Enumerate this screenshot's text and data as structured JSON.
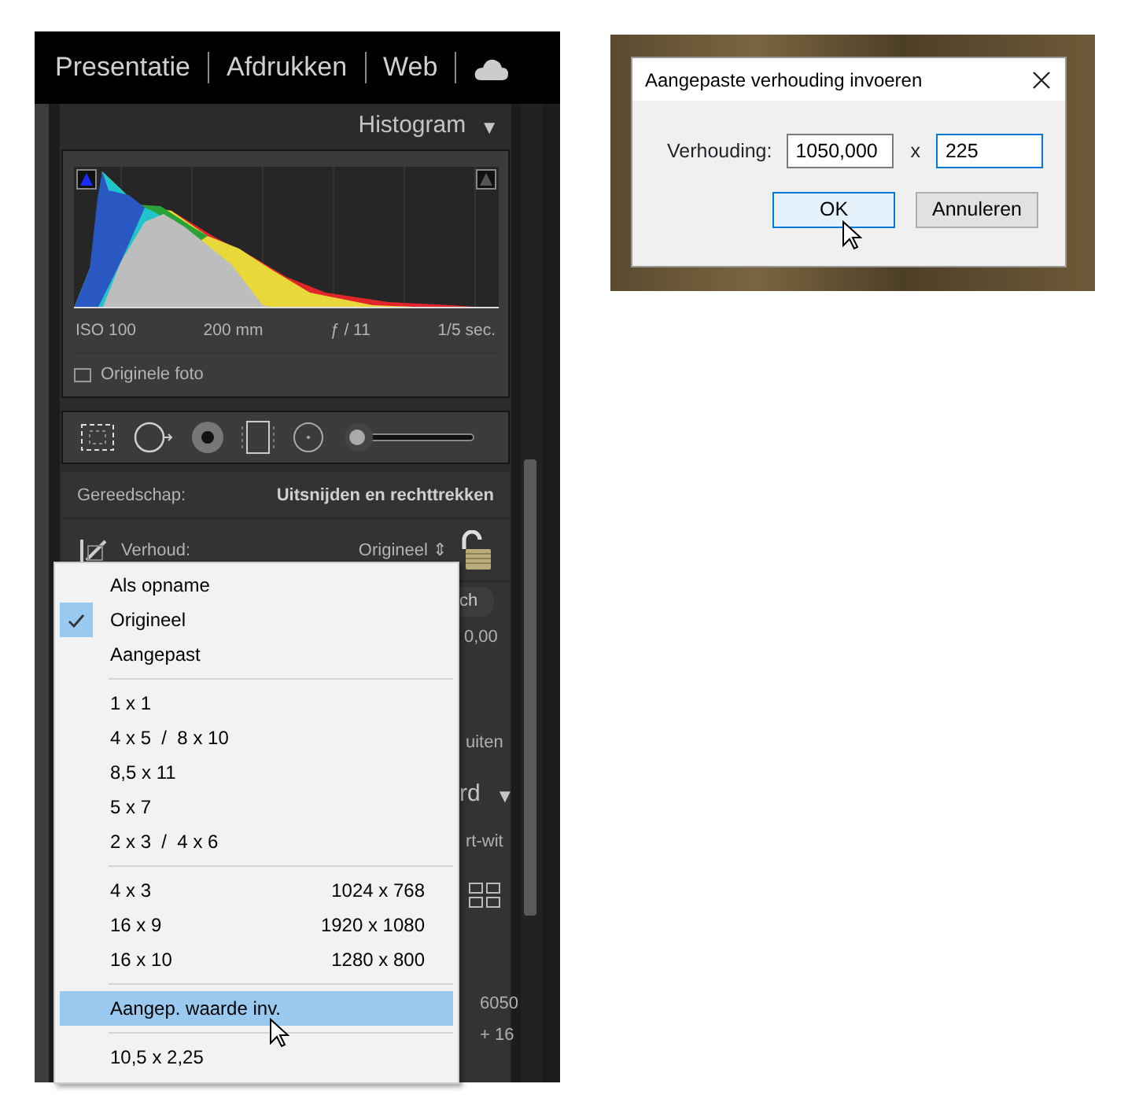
{
  "app_panel": {
    "top_nav": [
      {
        "label": "Presentatie"
      },
      {
        "label": "Afdrukken"
      },
      {
        "label": "Web"
      }
    ],
    "histogram": {
      "title": "Histogram",
      "collapse_glyph": "▼",
      "exif": [
        "ISO 100",
        "200 mm",
        "ƒ / 11",
        "1/5 sec."
      ],
      "original_photo": {
        "label": "Originele foto",
        "checked": false
      }
    },
    "brush_slider": {
      "level": 0.03
    },
    "crop_panel": {
      "tool_label": "Gereedschap:",
      "tool_value": "Uitsnijden en rechttrekken",
      "aspect_label": "Verhoud:",
      "aspect_value": "Origineel",
      "aspect_glyph": "⇕",
      "locked": false
    },
    "hidden_fragments": {
      "pill": "ch",
      "angle": "0,00",
      "reset": "uiten",
      "section_title": "rd",
      "section_glyph": "▼",
      "treatment": "rt-wit",
      "temperature": "6050",
      "tint": "+ 16"
    }
  },
  "aspect_menu": {
    "items": [
      {
        "kind": "item",
        "label": "Als opname",
        "checked": false,
        "selected": false
      },
      {
        "kind": "item",
        "label": "Origineel",
        "checked": true,
        "selected": false
      },
      {
        "kind": "item",
        "label": "Aangepast",
        "checked": false,
        "selected": false
      },
      {
        "kind": "separator"
      },
      {
        "kind": "item",
        "label": "1 x 1",
        "checked": false,
        "selected": false
      },
      {
        "kind": "item",
        "label": "4 x 5  /  8 x 10",
        "checked": false,
        "selected": false
      },
      {
        "kind": "item",
        "label": "8,5 x 11",
        "checked": false,
        "selected": false
      },
      {
        "kind": "item",
        "label": "5 x 7",
        "checked": false,
        "selected": false
      },
      {
        "kind": "item",
        "label": "2 x 3  /  4 x 6",
        "checked": false,
        "selected": false
      },
      {
        "kind": "separator"
      },
      {
        "kind": "item",
        "label": "4 x 3",
        "detail": "1024 x 768",
        "checked": false,
        "selected": false
      },
      {
        "kind": "item",
        "label": "16 x 9",
        "detail": "1920 x 1080",
        "checked": false,
        "selected": false
      },
      {
        "kind": "item",
        "label": "16 x 10",
        "detail": "1280 x 800",
        "checked": false,
        "selected": false
      },
      {
        "kind": "separator"
      },
      {
        "kind": "item",
        "label": "Aangep. waarde inv.",
        "checked": false,
        "selected": true
      },
      {
        "kind": "separator"
      },
      {
        "kind": "item",
        "label": "10,5 x 2,25",
        "checked": false,
        "selected": false
      }
    ]
  },
  "dialog": {
    "title": "Aangepaste verhouding invoeren",
    "label": "Verhouding:",
    "separator": "x",
    "fields": [
      {
        "value": "1050,000",
        "focused": false
      },
      {
        "value": "225",
        "focused": true
      }
    ],
    "buttons": [
      {
        "label": "OK",
        "default": true
      },
      {
        "label": "Annuleren",
        "default": false
      }
    ]
  }
}
